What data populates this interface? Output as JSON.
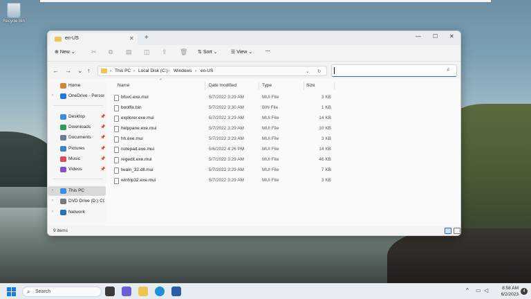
{
  "desktop": {
    "recycle_bin_label": "Recycle Bin"
  },
  "explorer": {
    "tab_title": "en-US",
    "toolbar": {
      "new_label": "New",
      "sort_label": "Sort",
      "view_label": "View",
      "more_label": "···"
    },
    "breadcrumb": [
      "This PC",
      "Local Disk (C:)",
      "Windows",
      "en-US"
    ],
    "search": {
      "value": ""
    },
    "nav_pane": {
      "quick": [
        {
          "label": "Home"
        },
        {
          "label": "OneDrive - Persona"
        }
      ],
      "pinned": [
        {
          "label": "Desktop"
        },
        {
          "label": "Downloads"
        },
        {
          "label": "Documents"
        },
        {
          "label": "Pictures"
        },
        {
          "label": "Music"
        },
        {
          "label": "Videos"
        }
      ],
      "devices": [
        {
          "label": "This PC"
        },
        {
          "label": "DVD Drive (D:) CCC"
        },
        {
          "label": "Network"
        }
      ]
    },
    "columns": {
      "name": "Name",
      "date": "Date modified",
      "type": "Type",
      "size": "Size"
    },
    "files": [
      {
        "name": "bfsvc.exe.mui",
        "date": "5/7/2022 3:29 AM",
        "type": "MUI File",
        "size": "3 KB"
      },
      {
        "name": "bootfix.bin",
        "date": "5/7/2022 3:30 AM",
        "type": "BIN File",
        "size": "1 KB"
      },
      {
        "name": "explorer.exe.mui",
        "date": "5/7/2022 3:29 AM",
        "type": "MUI File",
        "size": "14 KB"
      },
      {
        "name": "helppane.exe.mui",
        "date": "5/7/2022 3:29 AM",
        "type": "MUI File",
        "size": "10 KB"
      },
      {
        "name": "hh.exe.mui",
        "date": "5/7/2022 3:29 AM",
        "type": "MUI File",
        "size": "3 KB"
      },
      {
        "name": "notepad.exe.mui",
        "date": "5/6/2022 4:26 PM",
        "type": "MUI File",
        "size": "14 KB"
      },
      {
        "name": "regedit.exe.mui",
        "date": "5/7/2022 3:29 AM",
        "type": "MUI File",
        "size": "46 KB"
      },
      {
        "name": "twain_32.dll.mui",
        "date": "5/7/2022 3:29 AM",
        "type": "MUI File",
        "size": "7 KB"
      },
      {
        "name": "winhlp32.exe.mui",
        "date": "5/7/2022 3:29 AM",
        "type": "MUI File",
        "size": "3 KB"
      }
    ],
    "status": {
      "item_count": "9 items"
    }
  },
  "taskbar": {
    "search_label": "Search",
    "time": "8:58 AM",
    "date": "6/2/2023",
    "notification_count": "4"
  },
  "colors": {
    "accent": "#2b66c8",
    "folder": "#f0c453",
    "taskbar": "#e8edf3"
  }
}
